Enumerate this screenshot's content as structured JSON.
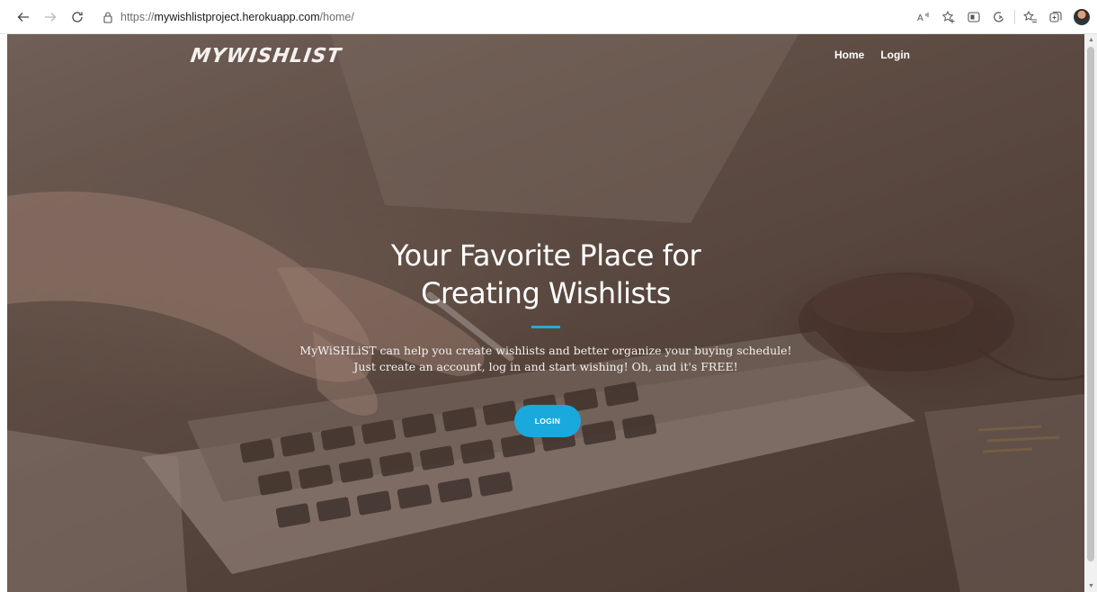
{
  "browser": {
    "url_prefix": "https://",
    "url_host": "mywishlistproject.herokuapp.com",
    "url_path": "/home/",
    "icons": [
      "back-icon",
      "forward-icon",
      "reload-icon",
      "lock-icon",
      "read-aloud-icon",
      "favorites-icon",
      "split-screen-icon",
      "browser-essentials-icon",
      "collections-icon",
      "extensions-icon",
      "profile-avatar"
    ]
  },
  "site": {
    "brand": "MYWISHLIST",
    "nav": {
      "home": "Home",
      "login": "Login"
    }
  },
  "hero": {
    "title_line1": "Your Favorite Place for",
    "title_line2": "Creating Wishlists",
    "subtitle_line1": "MyWiSHLiST can help you create wishlists and better organize your buying schedule!",
    "subtitle_line2": "Just create an account, log in and start wishing! Oh, and it's FREE!",
    "cta_label": "LOGIN"
  },
  "colors": {
    "accent": "#1aa9dd",
    "divider": "#29a8d8",
    "overlay": "#46302699"
  }
}
